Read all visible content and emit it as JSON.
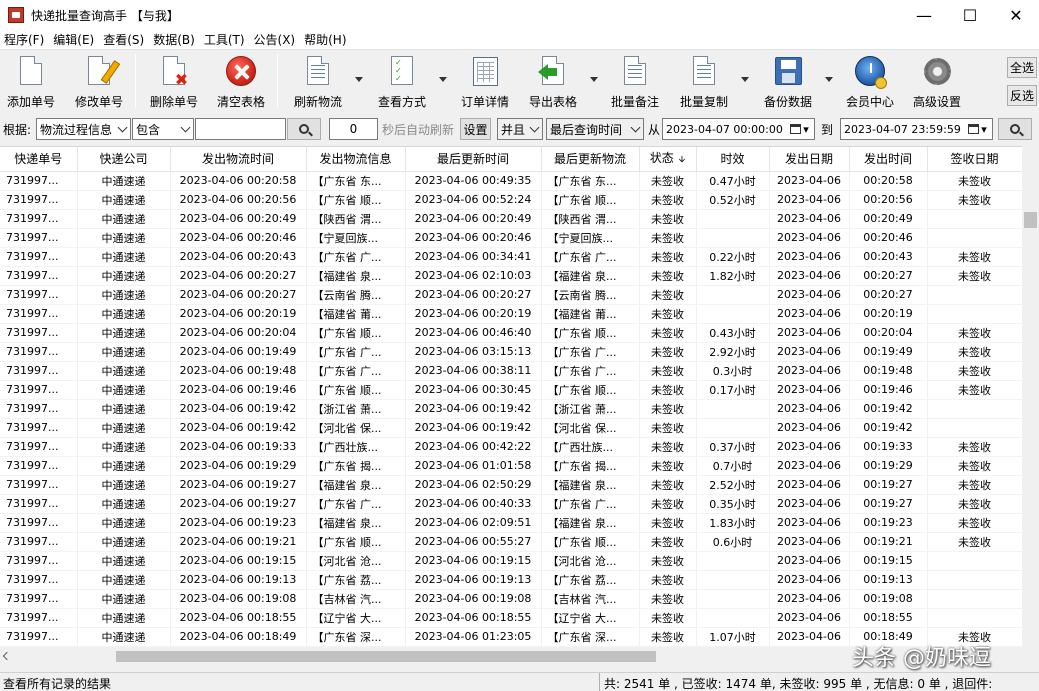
{
  "window": {
    "title": "快递批量查询高手 【与我】",
    "minimize": "—",
    "maximize": "☐",
    "close": "✕"
  },
  "menu": [
    "程序(F)",
    "编辑(E)",
    "查看(S)",
    "数据(B)",
    "工具(T)",
    "公告(X)",
    "帮助(H)"
  ],
  "toolbar": {
    "add": "添加单号",
    "modify": "修改单号",
    "delete": "删除单号",
    "clear": "清空表格",
    "refresh": "刷新物流",
    "view_mode": "查看方式",
    "order_detail": "订单详情",
    "export": "导出表格",
    "batch_note": "批量备注",
    "batch_copy": "批量复制",
    "backup": "备份数据",
    "member": "会员中心",
    "advanced": "高级设置",
    "select_all": "全选",
    "invert": "反选"
  },
  "filter": {
    "label": "根据:",
    "field": "物流过程信息",
    "match": "包含",
    "keyword": "",
    "seconds": "0",
    "auto_refresh_label": "秒后自动刷新",
    "settings": "设置",
    "logic": "并且",
    "time_field": "最后查询时间",
    "from_label": "从",
    "from_value": "2023-04-07 00:00:00",
    "to_label": "到",
    "to_value": "2023-04-07 23:59:59"
  },
  "columns": [
    "快递单号",
    "快递公司",
    "发出物流时间",
    "发出物流信息",
    "最后更新时间",
    "最后更新物流",
    "状态",
    "时效",
    "发出日期",
    "发出时间",
    "签收日期"
  ],
  "rows": [
    [
      "731997...",
      "中通速递",
      "2023-04-06 00:20:58",
      "【广东省 东...",
      "2023-04-06 00:49:35",
      "【广东省 东...",
      "未签收",
      "0.47小时",
      "2023-04-06",
      "00:20:58",
      "未签收"
    ],
    [
      "731997...",
      "中通速递",
      "2023-04-06 00:20:56",
      "【广东省 顺...",
      "2023-04-06 00:52:24",
      "【广东省 顺...",
      "未签收",
      "0.52小时",
      "2023-04-06",
      "00:20:56",
      "未签收"
    ],
    [
      "731997...",
      "中通速递",
      "2023-04-06 00:20:49",
      "【陕西省 渭...",
      "2023-04-06 00:20:49",
      "【陕西省 渭...",
      "未签收",
      "",
      "2023-04-06",
      "00:20:49",
      ""
    ],
    [
      "731997...",
      "中通速递",
      "2023-04-06 00:20:46",
      "【宁夏回族...",
      "2023-04-06 00:20:46",
      "【宁夏回族...",
      "未签收",
      "",
      "2023-04-06",
      "00:20:46",
      ""
    ],
    [
      "731997...",
      "中通速递",
      "2023-04-06 00:20:43",
      "【广东省 广...",
      "2023-04-06 00:34:41",
      "【广东省 广...",
      "未签收",
      "0.22小时",
      "2023-04-06",
      "00:20:43",
      "未签收"
    ],
    [
      "731997...",
      "中通速递",
      "2023-04-06 00:20:27",
      "【福建省 泉...",
      "2023-04-06 02:10:03",
      "【福建省 泉...",
      "未签收",
      "1.82小时",
      "2023-04-06",
      "00:20:27",
      "未签收"
    ],
    [
      "731997...",
      "中通速递",
      "2023-04-06 00:20:27",
      "【云南省 腾...",
      "2023-04-06 00:20:27",
      "【云南省 腾...",
      "未签收",
      "",
      "2023-04-06",
      "00:20:27",
      ""
    ],
    [
      "731997...",
      "中通速递",
      "2023-04-06 00:20:19",
      "【福建省 莆...",
      "2023-04-06 00:20:19",
      "【福建省 莆...",
      "未签收",
      "",
      "2023-04-06",
      "00:20:19",
      ""
    ],
    [
      "731997...",
      "中通速递",
      "2023-04-06 00:20:04",
      "【广东省 顺...",
      "2023-04-06 00:46:40",
      "【广东省 顺...",
      "未签收",
      "0.43小时",
      "2023-04-06",
      "00:20:04",
      "未签收"
    ],
    [
      "731997...",
      "中通速递",
      "2023-04-06 00:19:49",
      "【广东省 广...",
      "2023-04-06 03:15:13",
      "【广东省 广...",
      "未签收",
      "2.92小时",
      "2023-04-06",
      "00:19:49",
      "未签收"
    ],
    [
      "731997...",
      "中通速递",
      "2023-04-06 00:19:48",
      "【广东省 广...",
      "2023-04-06 00:38:11",
      "【广东省 广...",
      "未签收",
      "0.3小时",
      "2023-04-06",
      "00:19:48",
      "未签收"
    ],
    [
      "731997...",
      "中通速递",
      "2023-04-06 00:19:46",
      "【广东省 顺...",
      "2023-04-06 00:30:45",
      "【广东省 顺...",
      "未签收",
      "0.17小时",
      "2023-04-06",
      "00:19:46",
      "未签收"
    ],
    [
      "731997...",
      "中通速递",
      "2023-04-06 00:19:42",
      "【浙江省 萧...",
      "2023-04-06 00:19:42",
      "【浙江省 萧...",
      "未签收",
      "",
      "2023-04-06",
      "00:19:42",
      ""
    ],
    [
      "731997...",
      "中通速递",
      "2023-04-06 00:19:42",
      "【河北省 保...",
      "2023-04-06 00:19:42",
      "【河北省 保...",
      "未签收",
      "",
      "2023-04-06",
      "00:19:42",
      ""
    ],
    [
      "731997...",
      "中通速递",
      "2023-04-06 00:19:33",
      "【广西壮族...",
      "2023-04-06 00:42:22",
      "【广西壮族...",
      "未签收",
      "0.37小时",
      "2023-04-06",
      "00:19:33",
      "未签收"
    ],
    [
      "731997...",
      "中通速递",
      "2023-04-06 00:19:29",
      "【广东省 揭...",
      "2023-04-06 01:01:58",
      "【广东省 揭...",
      "未签收",
      "0.7小时",
      "2023-04-06",
      "00:19:29",
      "未签收"
    ],
    [
      "731997...",
      "中通速递",
      "2023-04-06 00:19:27",
      "【福建省 泉...",
      "2023-04-06 02:50:29",
      "【福建省 泉...",
      "未签收",
      "2.52小时",
      "2023-04-06",
      "00:19:27",
      "未签收"
    ],
    [
      "731997...",
      "中通速递",
      "2023-04-06 00:19:27",
      "【广东省 广...",
      "2023-04-06 00:40:33",
      "【广东省 广...",
      "未签收",
      "0.35小时",
      "2023-04-06",
      "00:19:27",
      "未签收"
    ],
    [
      "731997...",
      "中通速递",
      "2023-04-06 00:19:23",
      "【福建省 泉...",
      "2023-04-06 02:09:51",
      "【福建省 泉...",
      "未签收",
      "1.83小时",
      "2023-04-06",
      "00:19:23",
      "未签收"
    ],
    [
      "731997...",
      "中通速递",
      "2023-04-06 00:19:21",
      "【广东省 顺...",
      "2023-04-06 00:55:27",
      "【广东省 顺...",
      "未签收",
      "0.6小时",
      "2023-04-06",
      "00:19:21",
      "未签收"
    ],
    [
      "731997...",
      "中通速递",
      "2023-04-06 00:19:15",
      "【河北省 沧...",
      "2023-04-06 00:19:15",
      "【河北省 沧...",
      "未签收",
      "",
      "2023-04-06",
      "00:19:15",
      ""
    ],
    [
      "731997...",
      "中通速递",
      "2023-04-06 00:19:13",
      "【广东省 荔...",
      "2023-04-06 00:19:13",
      "【广东省 荔...",
      "未签收",
      "",
      "2023-04-06",
      "00:19:13",
      ""
    ],
    [
      "731997...",
      "中通速递",
      "2023-04-06 00:19:08",
      "【吉林省 汽...",
      "2023-04-06 00:19:08",
      "【吉林省 汽...",
      "未签收",
      "",
      "2023-04-06",
      "00:19:08",
      ""
    ],
    [
      "731997...",
      "中通速递",
      "2023-04-06 00:18:55",
      "【辽宁省 大...",
      "2023-04-06 00:18:55",
      "【辽宁省 大...",
      "未签收",
      "",
      "2023-04-06",
      "00:18:55",
      ""
    ],
    [
      "731997...",
      "中通速递",
      "2023-04-06 00:18:49",
      "【广东省 深...",
      "2023-04-06 01:23:05",
      "【广东省 深...",
      "未签收",
      "1.07小时",
      "2023-04-06",
      "00:18:49",
      "未签收"
    ]
  ],
  "status": {
    "left": "查看所有记录的结果",
    "right": "共: 2541 单 , 已签收:  1474 单, 未签收:  995 单 , 无信息: 0 单 , 退回件:"
  },
  "watermark": "头条 @奶味逗"
}
